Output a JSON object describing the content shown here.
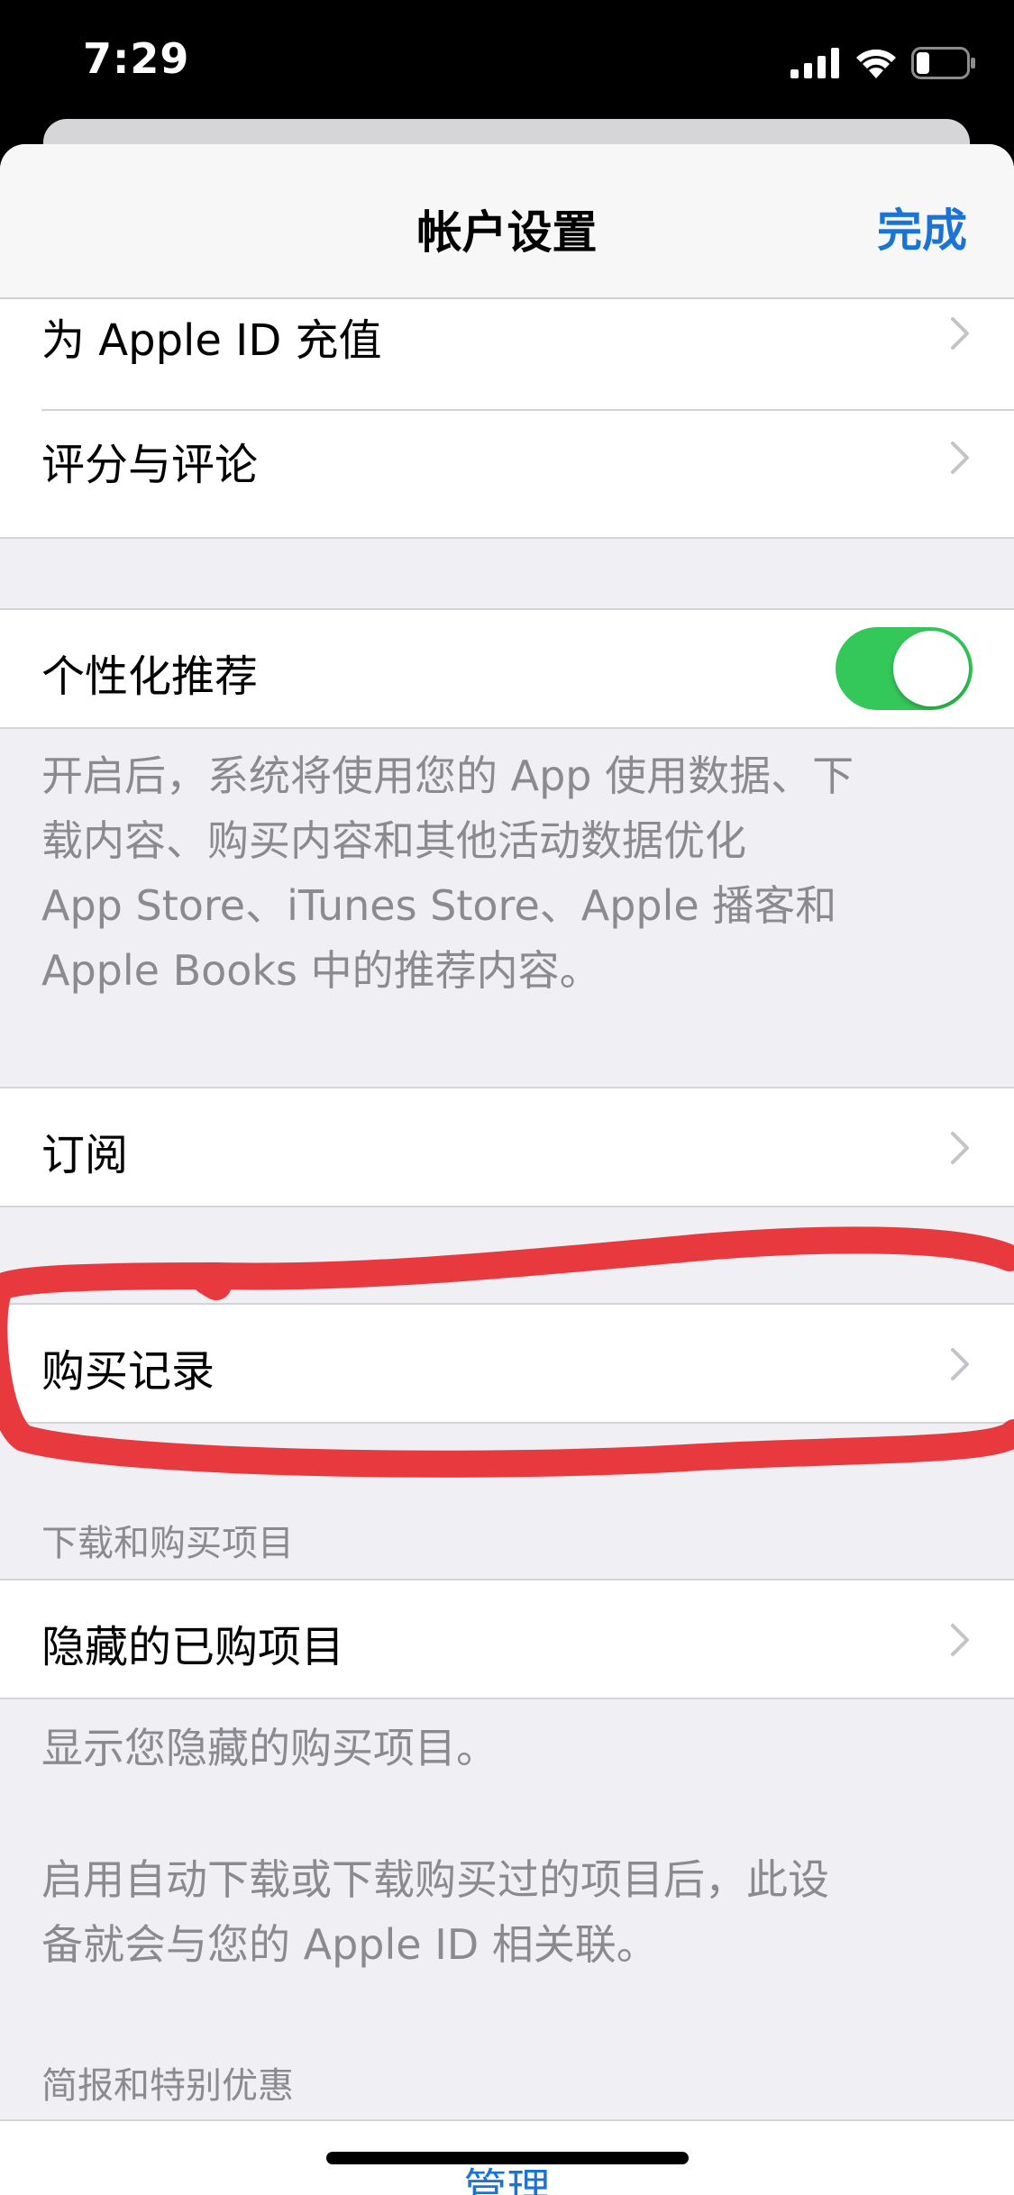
{
  "status_bar": {
    "time": "7:29",
    "signal_icon": "cellular-signal-icon",
    "wifi_icon": "wifi-icon",
    "battery_icon": "battery-icon"
  },
  "nav": {
    "title": "帐户设置",
    "done_label": "完成"
  },
  "rows": {
    "top_up": "为 Apple ID 充值",
    "ratings": "评分与评论",
    "personalized": "个性化推荐",
    "subscriptions": "订阅",
    "purchase_history": "购买记录",
    "hidden_purchases": "隐藏的已购项目"
  },
  "personalized_toggle": {
    "on": true,
    "color": "#34c759"
  },
  "footnotes": {
    "personalized_line1": "开启后，系统将使用您的 App 使用数据、下",
    "personalized_line2": "载内容、购买内容和其他活动数据优化",
    "personalized_line3": "App Store、iTunes Store、Apple 播客和",
    "personalized_line4": "Apple Books 中的推荐内容。",
    "hidden_note": "显示您隐藏的购买项目。",
    "auto_download_line1": "启用自动下载或下载购买过的项目后，此设",
    "auto_download_line2": "备就会与您的 Apple ID 相关联。"
  },
  "section_headers": {
    "downloads": "下载和购买项目",
    "newsletters": "简报和特别优惠"
  },
  "manage_label": "管理",
  "colors": {
    "accent": "#1b73d6",
    "annotation": "#e8393f"
  }
}
